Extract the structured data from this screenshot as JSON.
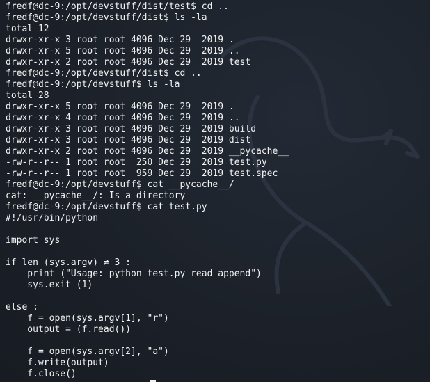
{
  "terminal": {
    "lines": [
      "fredf@dc-9:/opt/devstuff/dist/test$ cd ..",
      "fredf@dc-9:/opt/devstuff/dist$ ls -la",
      "total 12",
      "drwxr-xr-x 3 root root 4096 Dec 29  2019 .",
      "drwxr-xr-x 5 root root 4096 Dec 29  2019 ..",
      "drwxr-xr-x 2 root root 4096 Dec 29  2019 test",
      "fredf@dc-9:/opt/devstuff/dist$ cd ..",
      "fredf@dc-9:/opt/devstuff$ ls -la",
      "total 28",
      "drwxr-xr-x 5 root root 4096 Dec 29  2019 .",
      "drwxr-xr-x 4 root root 4096 Dec 29  2019 ..",
      "drwxr-xr-x 3 root root 4096 Dec 29  2019 build",
      "drwxr-xr-x 3 root root 4096 Dec 29  2019 dist",
      "drwxr-xr-x 2 root root 4096 Dec 29  2019 __pycache__",
      "-rw-r--r-- 1 root root  250 Dec 29  2019 test.py",
      "-rw-r--r-- 1 root root  959 Dec 29  2019 test.spec",
      "fredf@dc-9:/opt/devstuff$ cat __pycache__/",
      "cat: __pycache__/: Is a directory",
      "fredf@dc-9:/opt/devstuff$ cat test.py",
      "#!/usr/bin/python",
      "",
      "import sys",
      "",
      "if len (sys.argv) ≠ 3 :",
      "    print (\"Usage: python test.py read append\")",
      "    sys.exit (1)",
      "",
      "else :",
      "    f = open(sys.argv[1], \"r\")",
      "    output = (f.read())",
      "",
      "    f = open(sys.argv[2], \"a\")",
      "    f.write(output)",
      "    f.close()"
    ]
  }
}
